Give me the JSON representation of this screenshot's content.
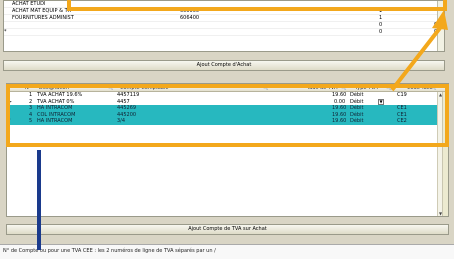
{
  "top_grid": {
    "rows": [
      {
        "marker": "",
        "designation": "ACHAT ETUDI",
        "compte": "",
        "col3": "",
        "col4": ""
      },
      {
        "marker": "",
        "designation": "ACHAT MAT EQUIP & TX",
        "compte": "605000",
        "col3": "1",
        "col4": ""
      },
      {
        "marker": "",
        "designation": "FOURNITURES ADMINIST",
        "compte": "606400",
        "col3": "1",
        "col4": ""
      },
      {
        "marker": "",
        "designation": "",
        "compte": "",
        "col3": "0",
        "col4": "0"
      },
      {
        "marker": "*",
        "designation": "",
        "compte": "",
        "col3": "0",
        "col4": "0"
      }
    ]
  },
  "buttons": {
    "add_achat": "Ajout Compte d'Achat",
    "add_tva": "Ajout Compte de TVA sur Achat"
  },
  "tva_grid": {
    "headers": {
      "num": "N°",
      "designation": "Désignation",
      "compte": "Compte Comptable",
      "taux": "Taux de TVA",
      "type": "Type TVA",
      "code": "Code Taxe"
    },
    "rows": [
      {
        "marker": "",
        "num": "1",
        "designation": "TVA ACHAT 19.6%",
        "compte": "4457119",
        "taux": "19.60",
        "type": "Débit",
        "code": "C19",
        "highlight": false
      },
      {
        "marker": "►",
        "num": "2",
        "designation": "TVA ACHAT 0%",
        "compte": "4457",
        "taux": "0.00",
        "type": "Débit",
        "code": "",
        "highlight": false
      },
      {
        "marker": "",
        "num": "3",
        "designation": "HA INTRACOM",
        "compte": "445269",
        "taux": "19.60",
        "type": "Débit",
        "code": "CE1",
        "highlight": true
      },
      {
        "marker": "",
        "num": "4",
        "designation": "COL INTRACOM",
        "compte": "445200",
        "taux": "19.60",
        "type": "Débit",
        "code": "CE1",
        "highlight": true
      },
      {
        "marker": "*",
        "num": "5",
        "designation": "HA INTRACOM",
        "compte": "3/4",
        "taux": "19.60",
        "type": "Débit",
        "code": "CE2",
        "highlight": true
      }
    ]
  },
  "status_bar": "N° de Compte ou pour une TVA CEE : les 2 numéros de ligne de TVA séparés par un /"
}
